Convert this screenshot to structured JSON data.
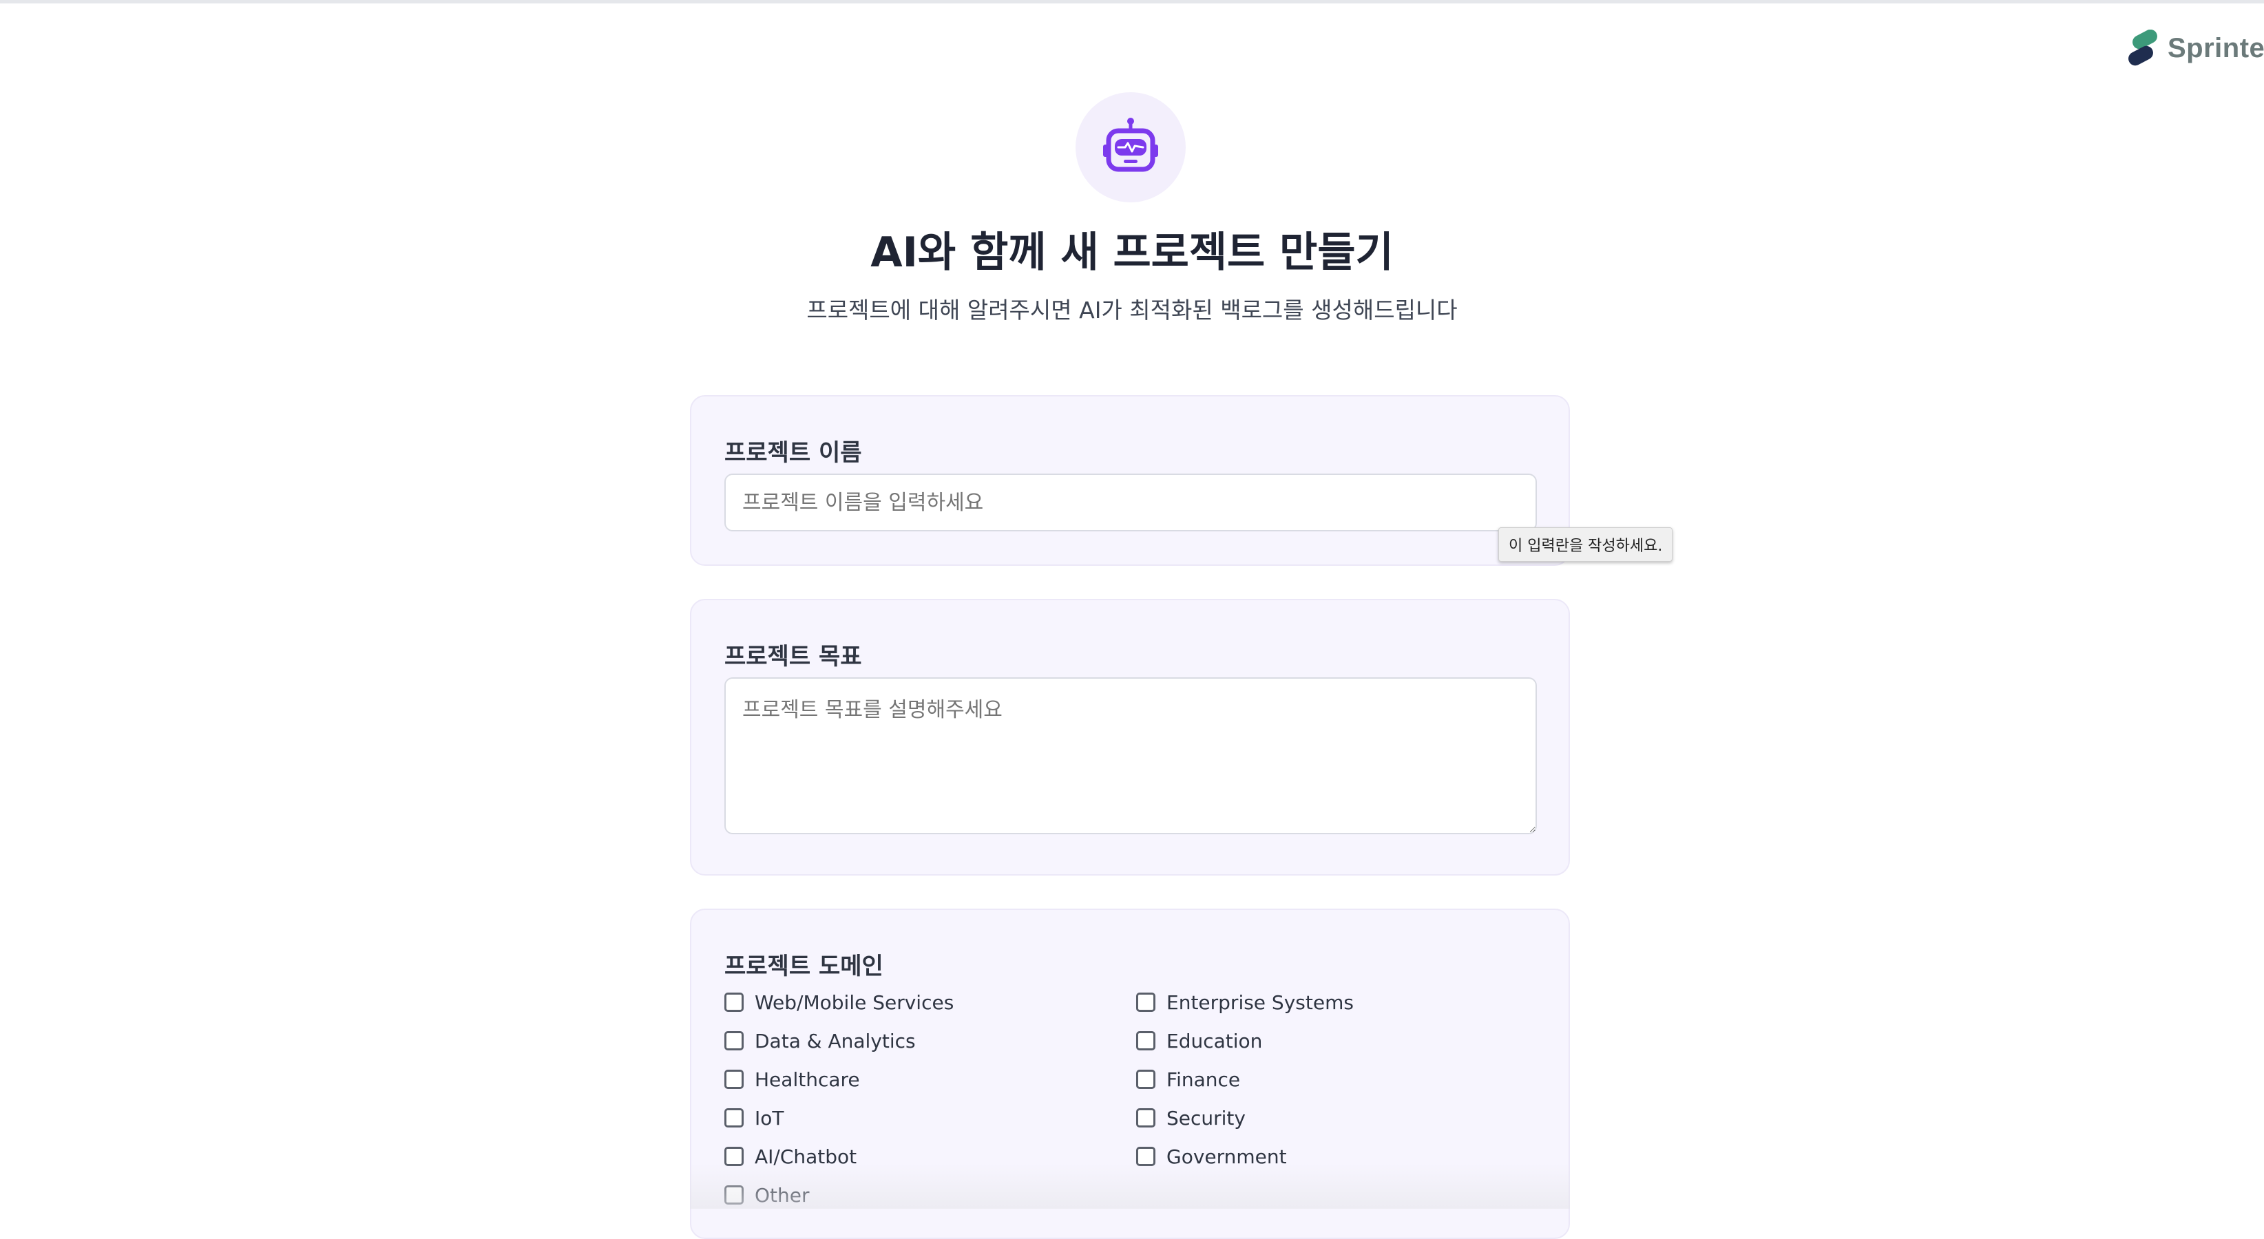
{
  "brand": {
    "name": "Sprinter"
  },
  "header": {
    "icon": "robot-icon",
    "title": "AI와 함께 새 프로젝트 만들기",
    "subtitle": "프로젝트에 대해 알려주시면 AI가 최적화된 백로그를 생성해드립니다"
  },
  "form": {
    "project_name": {
      "label": "프로젝트 이름",
      "placeholder": "프로젝트 이름을 입력하세요",
      "value": "",
      "tooltip": "이 입력란을 작성하세요."
    },
    "project_goal": {
      "label": "프로젝트 목표",
      "placeholder": "프로젝트 목표를 설명해주세요",
      "value": ""
    },
    "project_domain": {
      "label": "프로젝트 도메인",
      "options": [
        {
          "label": "Web/Mobile Services",
          "checked": false
        },
        {
          "label": "Enterprise Systems",
          "checked": false
        },
        {
          "label": "Data & Analytics",
          "checked": false
        },
        {
          "label": "Education",
          "checked": false
        },
        {
          "label": "Healthcare",
          "checked": false
        },
        {
          "label": "Finance",
          "checked": false
        },
        {
          "label": "IoT",
          "checked": false
        },
        {
          "label": "Security",
          "checked": false
        },
        {
          "label": "AI/Chatbot",
          "checked": false
        },
        {
          "label": "Government",
          "checked": false
        },
        {
          "label": "Other",
          "checked": false
        }
      ]
    }
  },
  "colors": {
    "accent": "#7c3aed",
    "card_bg": "#f7f5fe",
    "logo_green": "#3d9a7a",
    "logo_navy": "#1f2d4f"
  }
}
